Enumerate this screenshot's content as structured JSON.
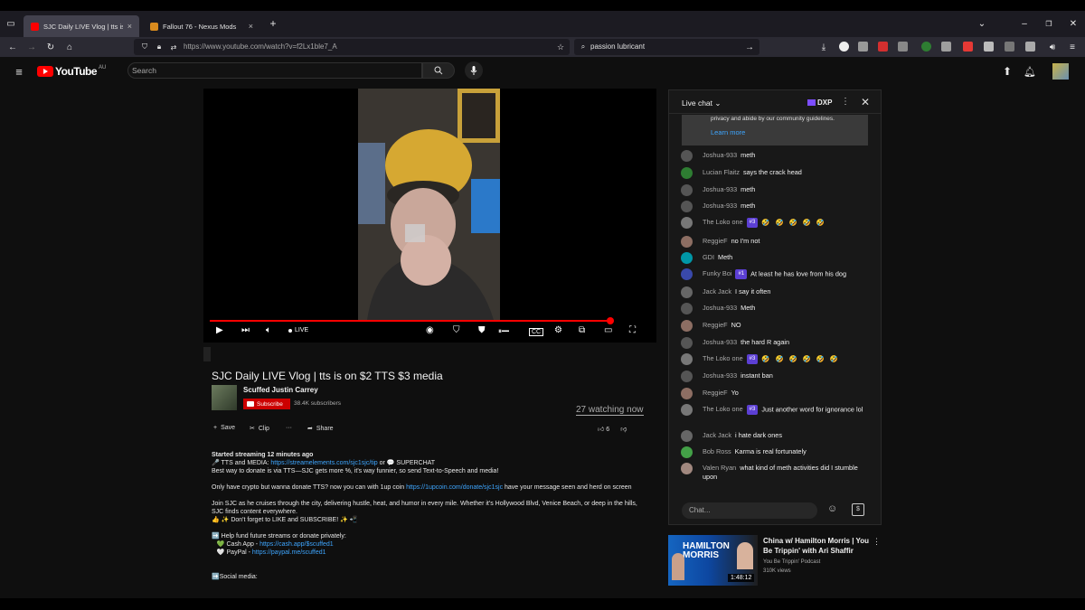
{
  "browser": {
    "tabs": [
      {
        "label": "SJC Daily LIVE Vlog | tts is on $2",
        "close": "×"
      },
      {
        "label": "Fallout 76 - Nexus Mods",
        "close": "×"
      }
    ],
    "new_tab": "+",
    "url": "https://www.youtube.com/watch?v=f2Lx1ble7_A",
    "search_query": "passion lubricant"
  },
  "youtube": {
    "logo_text": "YouTube",
    "logo_country": "AU",
    "search_placeholder": "Search"
  },
  "player": {
    "live_label": "LIVE",
    "progress": 0.91
  },
  "video": {
    "title": "SJC Daily LIVE Vlog | tts is on $2 TTS $3 media",
    "channel": "Scuffed Justin Carrey",
    "subscribe_label": "Subscribe",
    "subscribers": "38.4K subscribers",
    "watching": "27 watching now",
    "actions": {
      "save": "Save",
      "clip": "Clip",
      "more": "···",
      "share": "Share"
    },
    "likes": "6"
  },
  "description": {
    "started": "Started streaming 12 minutes ago",
    "tts_prefix": "🎤 TTS and MEDIA: ",
    "tts_link": "https://streamelements.com/sjc1sjc/tip",
    "tts_mid": " or 💬 SUPERCHAT",
    "donate_line": "Best way to donate is via TTS—SJC gets more %, it's way funnier, so send Text-to-Speech and media!",
    "crypto_prefix": "Only have crypto but wanna donate TTS? now you can with 1up coin ",
    "crypto_link": "https://1upcoin.com/donate/sjc1sjc",
    "crypto_suffix": " have your message seen and herd on screen",
    "join_line": "Join SJC as he cruises through the city, delivering hustle, heat, and humor in every mile. Whether it's Hollywood Blvd, Venice Beach, or deep in the hills, SJC finds content everywhere.",
    "like_line": "👍 ✨ Don't forget to LIKE and SUBSCRIBE! ✨ 📲",
    "fund_line": "➡️ Help fund future streams or donate privately:",
    "cashapp_prefix": "💚 Cash App - ",
    "cashapp_link": "https://cash.app/$scuffed1",
    "paypal_prefix": "🤍 PayPal - ",
    "paypal_link": "https://paypal.me/scuffed1",
    "social": "➡️Social media:"
  },
  "chat": {
    "title": "Live chat",
    "points": "DXP",
    "pinned_text": "privacy and abide by our community guidelines.",
    "learn_more": "Learn more",
    "input_placeholder": "Chat...",
    "messages": [
      {
        "user": "Joshua-933",
        "text": "meth",
        "badge": "",
        "color": "#555"
      },
      {
        "user": "Lucian Flaitz",
        "text": "says the crack head",
        "badge": "",
        "color": "#2e7d32"
      },
      {
        "user": "Joshua-933",
        "text": "meth",
        "badge": "",
        "color": "#555"
      },
      {
        "user": "Joshua-933",
        "text": "meth",
        "badge": "",
        "color": "#555"
      },
      {
        "user": "The Loko one",
        "text": "🤣 🤣 🤣 🤣 🤣",
        "badge": "#3",
        "color": "#777"
      },
      {
        "user": "ReggieF",
        "text": "no I'm not",
        "badge": "",
        "color": "#8d6e63"
      },
      {
        "user": "GDI",
        "text": "Meth",
        "badge": "",
        "color": "#0097a7"
      },
      {
        "user": "Funky Boi",
        "text": "At least he has love from his dog",
        "badge": "#1",
        "color": "#3949ab"
      },
      {
        "user": "Jack Jack",
        "text": "I say it often",
        "badge": "",
        "color": "#666"
      },
      {
        "user": "Joshua-933",
        "text": "Meth",
        "badge": "",
        "color": "#555"
      },
      {
        "user": "ReggieF",
        "text": "NO",
        "badge": "",
        "color": "#8d6e63"
      },
      {
        "user": "Joshua-933",
        "text": "the hard R again",
        "badge": "",
        "color": "#555"
      },
      {
        "user": "The Loko one",
        "text": "🤣 🤣 🤣 🤣 🤣 🤣",
        "badge": "#3",
        "color": "#777"
      },
      {
        "user": "Joshua-933",
        "text": "instant ban",
        "badge": "",
        "color": "#555"
      },
      {
        "user": "ReggieF",
        "text": "Yo",
        "badge": "",
        "color": "#8d6e63"
      },
      {
        "user": "The Loko one",
        "text": "Just another word for ignorance lol",
        "badge": "#3",
        "color": "#777"
      },
      {
        "user": "Jack Jack",
        "text": "i hate dark ones",
        "badge": "",
        "color": "#666"
      },
      {
        "user": "Bob Ross",
        "text": "Karma is real fortunately",
        "badge": "",
        "color": "#43a047"
      },
      {
        "user": "Valen Ryan",
        "text": "what kind of meth activities did I stumble upon",
        "badge": "",
        "color": "#a1887f"
      }
    ]
  },
  "recommendation": {
    "thumb_text": "HAMILTON MORRIS",
    "duration": "1:48:12",
    "title": "China w/ Hamilton Morris | You Be Trippin' with Ari Shaffir",
    "channel": "You Be Trippin' Podcast",
    "views": "310K views"
  }
}
